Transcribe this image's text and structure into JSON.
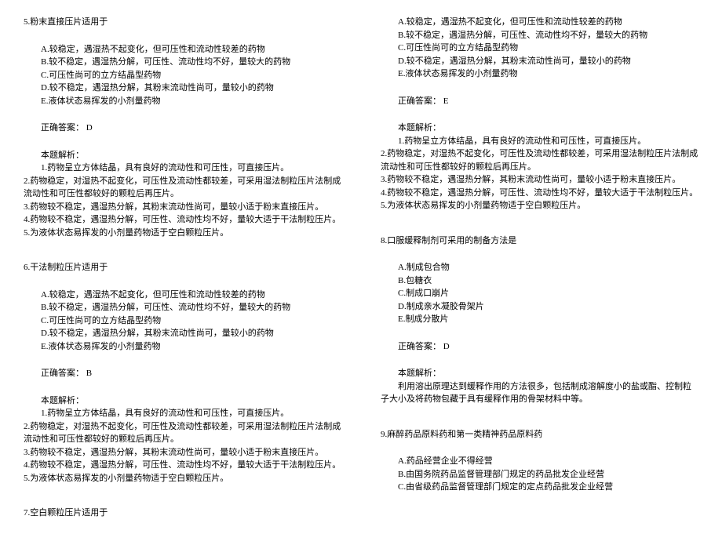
{
  "q5": {
    "title": "5.粉末直接压片适用于",
    "opts": [
      "A.较稳定，遇湿热不起变化，但可压性和流动性较差的药物",
      "B.较不稳定，遇湿热分解，可压性、流动性均不好，量较大的药物",
      "C.可压性尚可的立方结晶型药物",
      "D.较不稳定，遇湿热分解，其粉末流动性尚可，量较小的药物",
      "E.液体状态易挥发的小剂量药物"
    ],
    "answer": "正确答案：  D",
    "ana_title": "本题解析：",
    "ana": [
      "1.药物呈立方体结晶，具有良好的流动性和可压性，可直接压片。",
      "2.药物稳定，对湿热不起变化，可压性及流动性都较差，可采用湿法制粒压片法制成流动性和可压性都较好的颗粒后再压片。",
      "3.药物较不稳定，遇湿热分解，其粉末流动性尚可，量较小适于粉末直接压片。",
      "4.药物较不稳定，遇湿热分解，可压性、流动性均不好，量较大适于干法制粒压片。",
      "5.为液体状态易挥发的小剂量药物适于空白颗粒压片。"
    ]
  },
  "q6": {
    "title": "6.干法制粒压片适用于",
    "opts": [
      "A.较稳定，遇湿热不起变化，但可压性和流动性较差的药物",
      "B.较不稳定，遇湿热分解，可压性、流动性均不好，量较大的药物",
      "C.可压性尚可的立方结晶型药物",
      "D.较不稳定，遇湿热分解，其粉末流动性尚可，量较小的药物",
      "E.液体状态易挥发的小剂量药物"
    ],
    "answer": "正确答案：  B",
    "ana_title": "本题解析：",
    "ana": [
      "1.药物呈立方体结晶，具有良好的流动性和可压性，可直接压片。",
      "2.药物稳定，对湿热不起变化，可压性及流动性都较差，可采用湿法制粒压片法制成流动性和可压性都较好的颗粒后再压片。",
      "3.药物较不稳定，遇湿热分解，其粉末流动性尚可，量较小适于粉末直接压片。",
      "4.药物较不稳定，遇湿热分解，可压性、流动性均不好，量较大适于干法制粒压片。",
      "5.为液体状态易挥发的小剂量药物适于空白颗粒压片。"
    ]
  },
  "q7": {
    "title": "7.空白颗粒压片适用于",
    "opts": [
      "A.较稳定，遇湿热不起变化，但可压性和流动性较差的药物",
      "B.较不稳定，遇湿热分解，可压性、流动性均不好，量较大的药物",
      "C.可压性尚可的立方结晶型药物",
      "D.较不稳定，遇湿热分解，其粉末流动性尚可，量较小的药物",
      "E.液体状态易挥发的小剂量药物"
    ],
    "answer": "正确答案：  E",
    "ana_title": "本题解析：",
    "ana": [
      "1.药物呈立方体结晶，具有良好的流动性和可压性，可直接压片。",
      "2.药物稳定，对湿热不起变化，可压性及流动性都较差，可采用湿法制粒压片法制成流动性和可压性都较好的颗粒后再压片。",
      "3.药物较不稳定，遇湿热分解，其粉末流动性尚可，量较小适于粉末直接压片。",
      "4.药物较不稳定，遇湿热分解，可压性、流动性均不好，量较大适于干法制粒压片。",
      "5.为液体状态易挥发的小剂量药物适于空白颗粒压片。"
    ]
  },
  "q8": {
    "title": "8.口服缓释制剂可采用的制备方法是",
    "opts": [
      "A.制成包合物",
      "B.包糖衣",
      "C.制成口崩片",
      "D.制成亲水凝胶骨架片",
      "E.制成分散片"
    ],
    "answer": "正确答案：  D",
    "ana_title": "本题解析：",
    "ana": [
      "利用溶出原理达到缓释作用的方法很多，包括制成溶解度小的盐或酯、控制粒子大小及将药物包藏于具有缓释作用的骨架材料中等。"
    ]
  },
  "q9": {
    "title": "9.麻醉药品原料药和第一类精神药品原料药",
    "opts": [
      "A.药品经营企业不得经营",
      "B.由国务院药品监督管理部门规定的药品批发企业经营",
      "C.由省级药品监督管理部门规定的定点药品批发企业经营"
    ]
  }
}
